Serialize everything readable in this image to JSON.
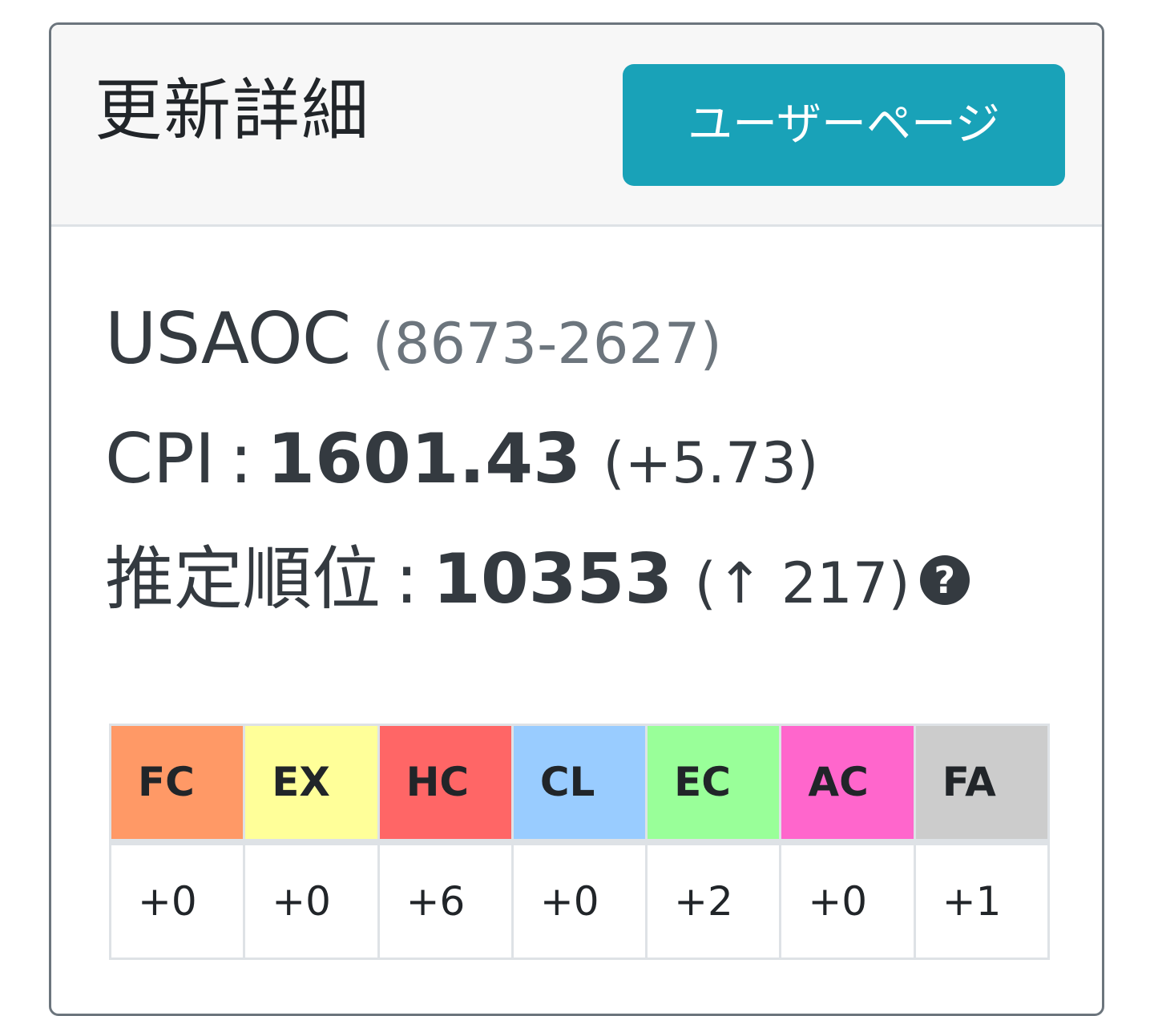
{
  "header": {
    "title": "更新詳細",
    "user_page_button": "ユーザーページ"
  },
  "player": {
    "name": "USAOC",
    "id": "(8673-2627)"
  },
  "cpi": {
    "label": "CPI",
    "separator": ":",
    "value": "1601.43",
    "delta": "(+5.73)"
  },
  "rank": {
    "label": "推定順位",
    "separator": ":",
    "value": "10353",
    "delta": "(↑ 217)",
    "help_icon": "question-circle-icon",
    "help_glyph": "?"
  },
  "lamps": {
    "columns": [
      {
        "label": "FC",
        "value": "+0",
        "color": "#ff9966"
      },
      {
        "label": "EX",
        "value": "+0",
        "color": "#ffff99"
      },
      {
        "label": "HC",
        "value": "+6",
        "color": "#ff6666"
      },
      {
        "label": "CL",
        "value": "+0",
        "color": "#99ccff"
      },
      {
        "label": "EC",
        "value": "+2",
        "color": "#99ff99"
      },
      {
        "label": "AC",
        "value": "+0",
        "color": "#ff66cc"
      },
      {
        "label": "FA",
        "value": "+1",
        "color": "#cccccc"
      }
    ]
  },
  "colors": {
    "button": "#19a2b8",
    "header_bg": "#f7f7f7",
    "text": "#343a40",
    "muted": "#6c757d"
  }
}
